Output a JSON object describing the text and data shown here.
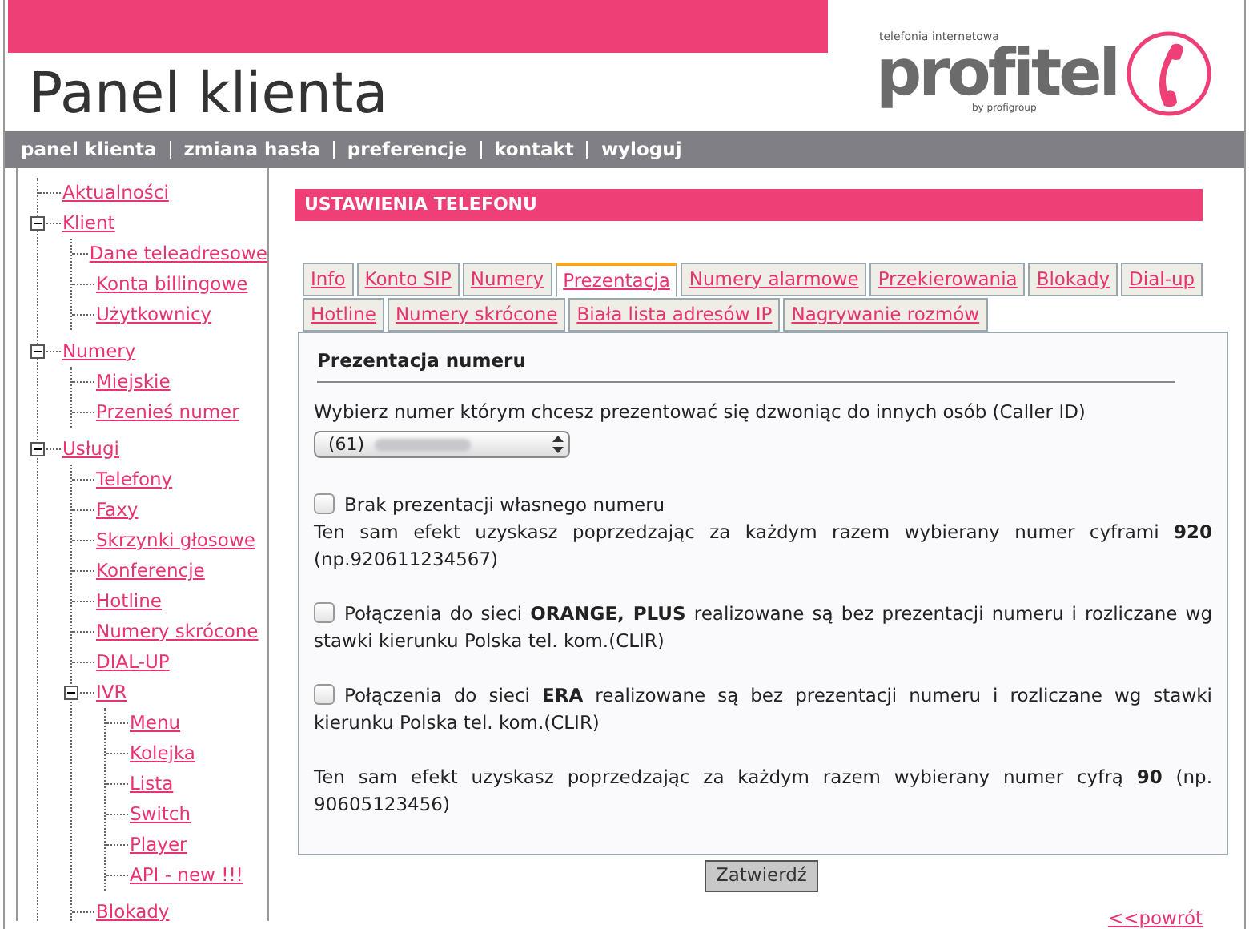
{
  "header": {
    "title": "Panel klienta",
    "logo": {
      "tagline": "telefonia internetowa",
      "name": "profitel",
      "byline": "by profigroup"
    }
  },
  "nav": [
    "panel klienta",
    "zmiana hasła",
    "preferencje",
    "kontakt",
    "wyloguj"
  ],
  "sidebar": {
    "items": [
      {
        "label": "Aktualności"
      },
      {
        "label": "Klient",
        "expanded": true,
        "children": [
          {
            "label": "Dane teleadresowe"
          },
          {
            "label": "Konta billingowe"
          },
          {
            "label": "Użytkownicy"
          }
        ]
      },
      {
        "label": "Numery",
        "expanded": true,
        "children": [
          {
            "label": "Miejskie"
          },
          {
            "label": "Przenieś numer"
          }
        ]
      },
      {
        "label": "Usługi",
        "expanded": true,
        "children": [
          {
            "label": "Telefony"
          },
          {
            "label": "Faxy"
          },
          {
            "label": "Skrzynki głosowe"
          },
          {
            "label": "Konferencje"
          },
          {
            "label": "Hotline"
          },
          {
            "label": "Numery skrócone"
          },
          {
            "label": "DIAL-UP"
          },
          {
            "label": "IVR",
            "expanded": true,
            "children": [
              {
                "label": "Menu"
              },
              {
                "label": "Kolejka"
              },
              {
                "label": "Lista"
              },
              {
                "label": "Switch"
              },
              {
                "label": "Player"
              },
              {
                "label": "API - new !!!"
              }
            ]
          },
          {
            "label": "Blokady"
          }
        ]
      }
    ]
  },
  "section_title": "USTAWIENIA TELEFONU",
  "tabs": [
    [
      {
        "label": "Info",
        "selected": false
      },
      {
        "label": "Konto SIP",
        "selected": false
      },
      {
        "label": "Numery",
        "selected": false
      },
      {
        "label": "Prezentacja",
        "selected": true
      },
      {
        "label": "Numery alarmowe",
        "selected": false
      },
      {
        "label": "Przekierowania",
        "selected": false
      },
      {
        "label": "Blokady",
        "selected": false
      },
      {
        "label": "Dial-up",
        "selected": false
      }
    ],
    [
      {
        "label": "Hotline",
        "selected": false
      },
      {
        "label": "Numery skrócone",
        "selected": false
      },
      {
        "label": "Biała lista adresów IP",
        "selected": false
      },
      {
        "label": "Nagrywanie rozmów",
        "selected": false
      }
    ]
  ],
  "panel": {
    "heading": "Prezentacja numeru",
    "select_label": "Wybierz numer którym chcesz prezentować się dzwoniąc do innych osób (Caller ID)",
    "select_value": "(61)",
    "options": [
      {
        "kind": "checkbox",
        "checked": false,
        "label": "Brak prezentacji własnego numeru"
      },
      {
        "kind": "note",
        "text": "Ten sam efekt uzyskasz poprzedzając za każdym razem wybierany numer cyframi **920** (np.920611234567)"
      },
      {
        "kind": "checkbox",
        "checked": false,
        "label": "Połączenia do sieci **ORANGE, PLUS** realizowane są bez prezentacji numeru i rozliczane wg stawki kierunku Polska tel. kom.(CLIR)"
      },
      {
        "kind": "checkbox",
        "checked": false,
        "label": "Połączenia do sieci **ERA** realizowane są bez prezentacji numeru i rozliczane wg stawki kierunku Polska tel. kom.(CLIR)"
      },
      {
        "kind": "note",
        "text": "Ten sam efekt uzyskasz poprzedzając za każdym razem wybierany numer cyfrą **90** (np. 90605123456)"
      }
    ]
  },
  "submit": "Zatwierdź",
  "back_link": "<<powrót"
}
